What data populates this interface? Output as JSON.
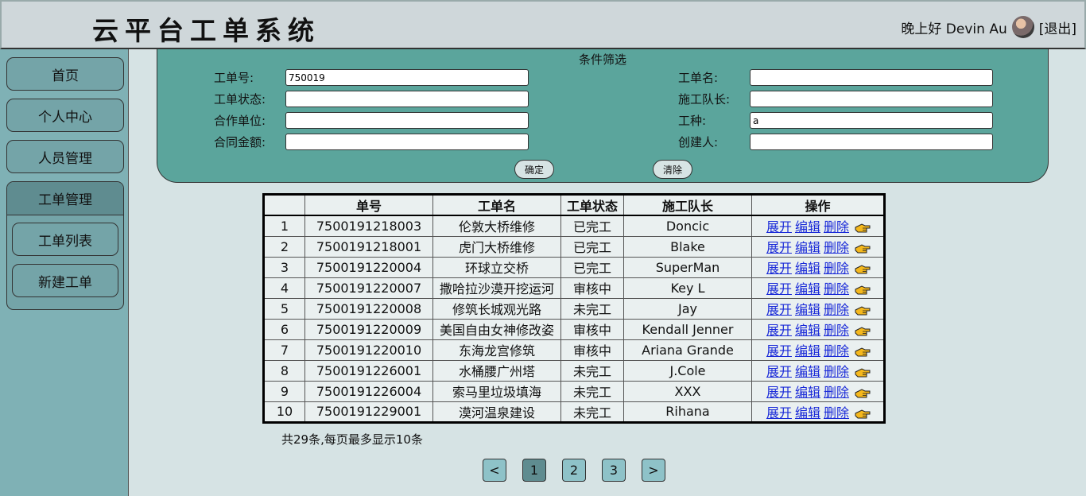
{
  "header": {
    "title": "云平台工单系统",
    "greeting": "晚上好 Devin Au",
    "logout": "[退出]"
  },
  "sidebar": {
    "home": "首页",
    "profile": "个人中心",
    "staff": "人员管理",
    "workorder_group": "工单管理",
    "workorder_list": "工单列表",
    "new_workorder": "新建工单"
  },
  "filter": {
    "title": "条件筛选",
    "order_no_label": "工单号:",
    "order_no_value": "750019",
    "order_name_label": "工单名:",
    "order_name_value": "",
    "status_label": "工单状态:",
    "status_value": "",
    "leader_label": "施工队长:",
    "leader_value": "",
    "partner_label": "合作单位:",
    "partner_value": "",
    "type_label": "工种:",
    "type_value": "a",
    "amount_label": "合同金额:",
    "amount_value": "",
    "creator_label": "创建人:",
    "creator_value": "",
    "confirm": "确定",
    "clear": "清除"
  },
  "table": {
    "headers": [
      "",
      "单号",
      "工单名",
      "工单状态",
      "施工队长",
      "操作"
    ],
    "actions": {
      "expand": "展开",
      "edit": "编辑",
      "delete": "删除"
    },
    "rows": [
      {
        "idx": "1",
        "no": "7500191218003",
        "name": "伦敦大桥维修",
        "status": "已完工",
        "leader": "Doncic"
      },
      {
        "idx": "2",
        "no": "7500191218001",
        "name": "虎门大桥维修",
        "status": "已完工",
        "leader": "Blake"
      },
      {
        "idx": "3",
        "no": "7500191220004",
        "name": "环球立交桥",
        "status": "已完工",
        "leader": "SuperMan"
      },
      {
        "idx": "4",
        "no": "7500191220007",
        "name": "撒哈拉沙漠开挖运河",
        "status": "审核中",
        "leader": "Key L"
      },
      {
        "idx": "5",
        "no": "7500191220008",
        "name": "修筑长城观光路",
        "status": "未完工",
        "leader": "Jay"
      },
      {
        "idx": "6",
        "no": "7500191220009",
        "name": "美国自由女神修改姿",
        "status": "审核中",
        "leader": "Kendall Jenner"
      },
      {
        "idx": "7",
        "no": "7500191220010",
        "name": "东海龙宫修筑",
        "status": "审核中",
        "leader": "Ariana Grande"
      },
      {
        "idx": "8",
        "no": "7500191226001",
        "name": "水桶腰广州塔",
        "status": "未完工",
        "leader": "J.Cole"
      },
      {
        "idx": "9",
        "no": "7500191226004",
        "name": "索马里垃圾填海",
        "status": "未完工",
        "leader": "XXX"
      },
      {
        "idx": "10",
        "no": "7500191229001",
        "name": "漠河温泉建设",
        "status": "未完工",
        "leader": "Rihana"
      }
    ]
  },
  "summary": "共29条,每页最多显示10条",
  "pagination": {
    "prev": "<",
    "pages": [
      "1",
      "2",
      "3"
    ],
    "current": "1",
    "next": ">"
  },
  "colors": {
    "sidebar": "#7fb1b5",
    "filter_panel": "#5ba59c",
    "link": "#1a2ad8"
  }
}
